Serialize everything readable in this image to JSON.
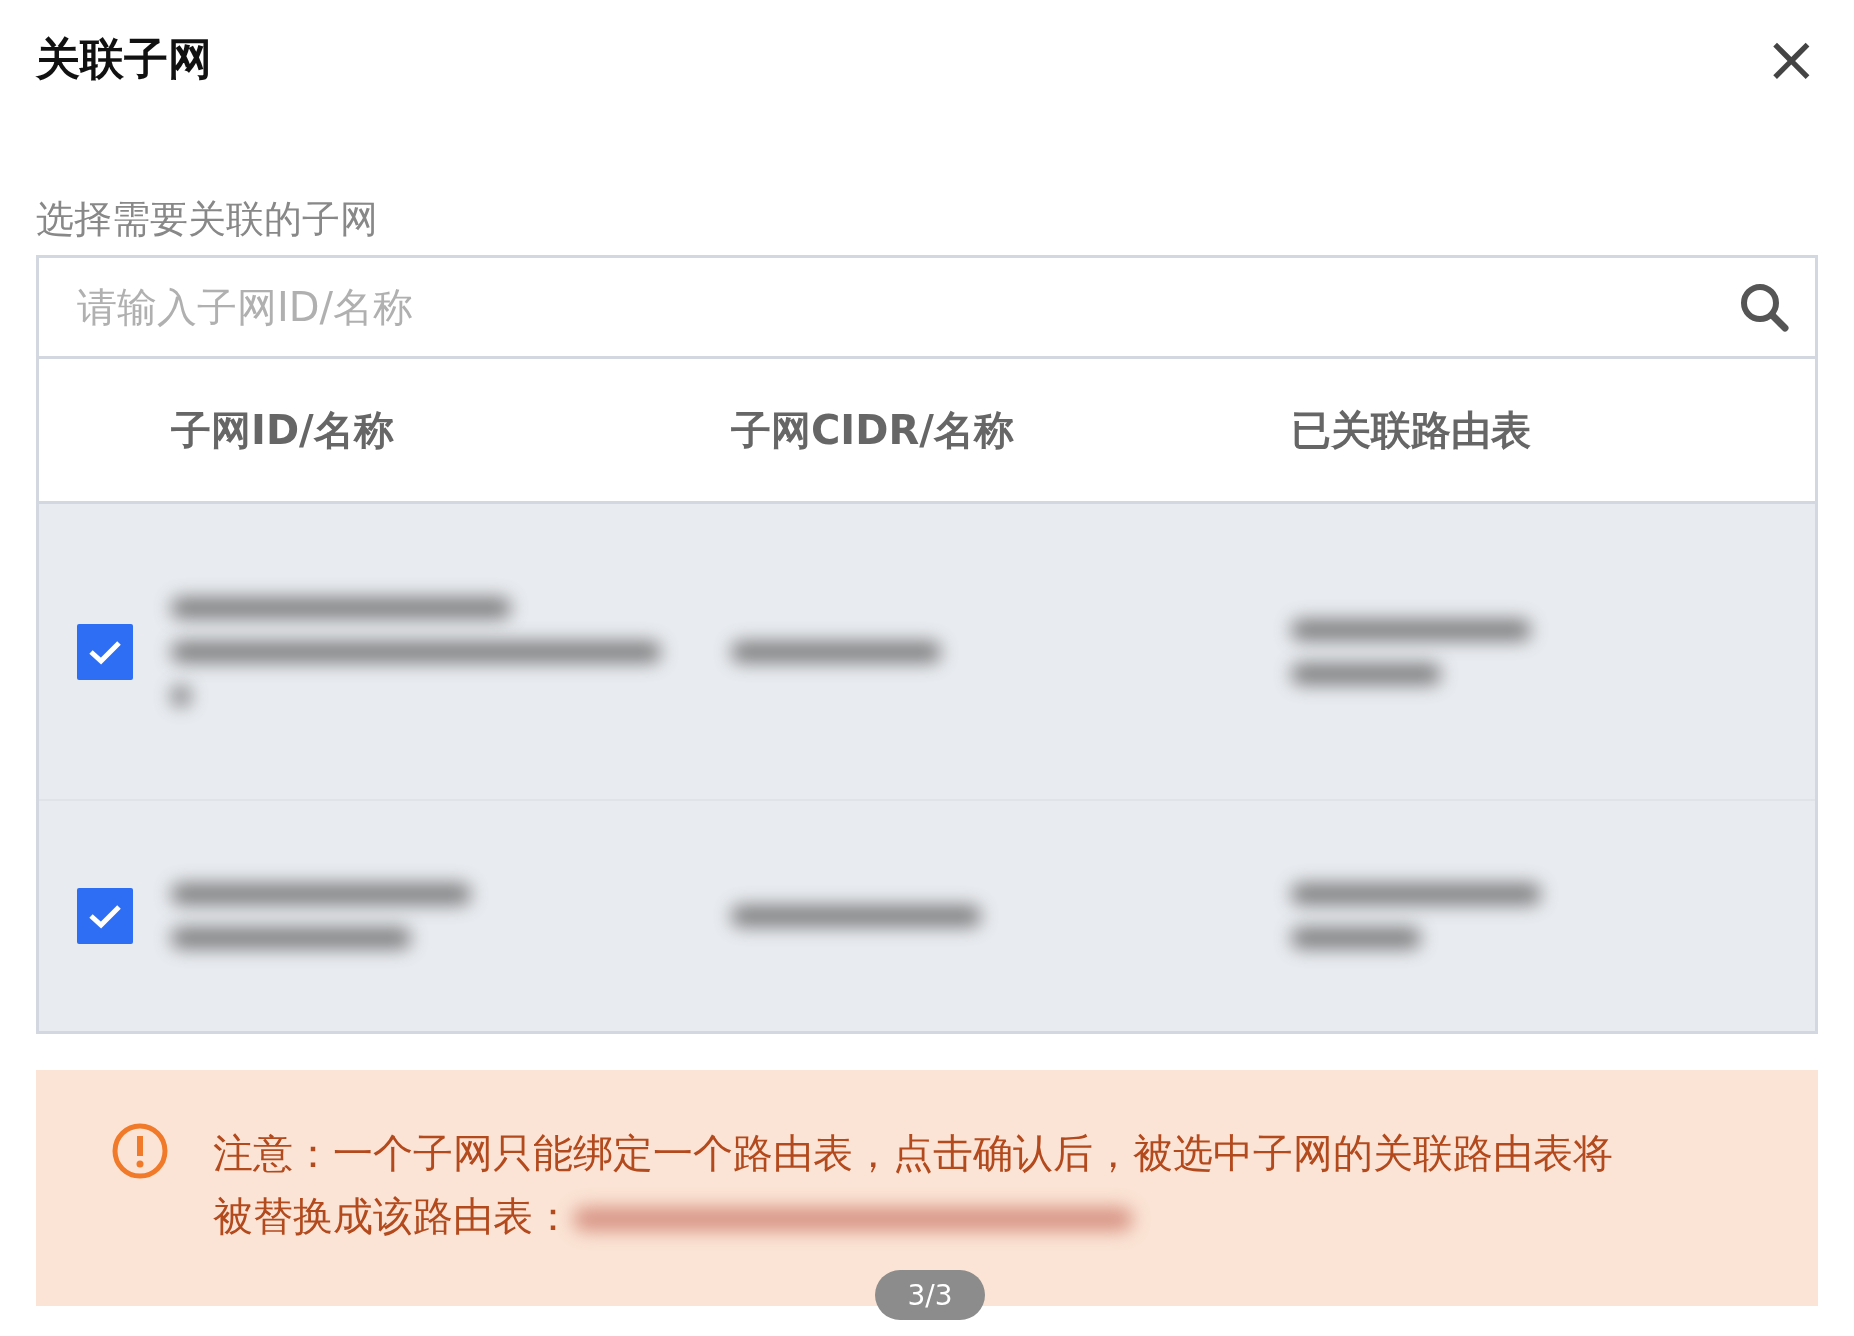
{
  "dialog": {
    "title": "关联子网",
    "close": "×"
  },
  "field_label": "选择需要关联的子网",
  "search": {
    "placeholder": "请输入子网ID/名称"
  },
  "table": {
    "columns": [
      "子网ID/名称",
      "子网CIDR/名称",
      "已关联路由表"
    ],
    "rows": [
      {
        "selected": true
      },
      {
        "selected": true
      }
    ]
  },
  "notice": {
    "text": "注意：一个子网只能绑定一个路由表，点击确认后，被选中子网的关联路由表将被替换成该路由表："
  },
  "pager": "3/3"
}
